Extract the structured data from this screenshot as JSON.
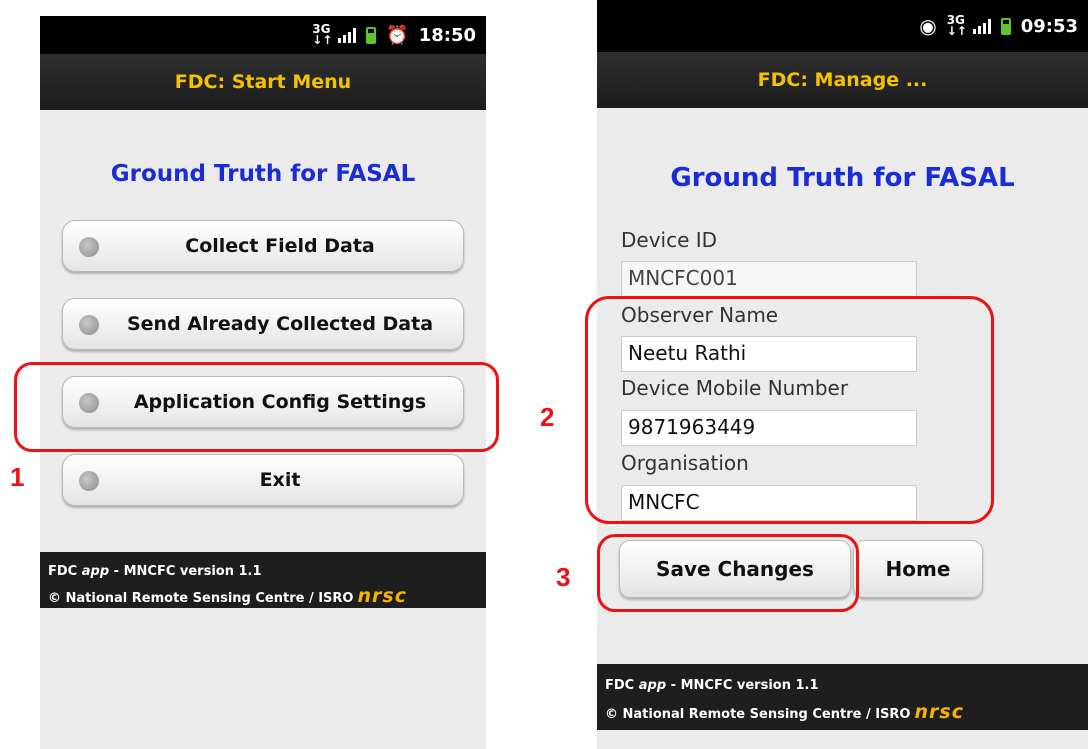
{
  "left_screen": {
    "status": {
      "network": "3G",
      "time": "18:50",
      "icons": [
        "3g-icon",
        "signal-icon",
        "battery-icon",
        "alarm-icon"
      ]
    },
    "title": "FDC: Start Menu",
    "heading": "Ground Truth for FASAL",
    "menu": [
      {
        "label": "Collect Field Data"
      },
      {
        "label": "Send Already Collected Data"
      },
      {
        "label": "Application Config Settings"
      },
      {
        "label": "Exit"
      }
    ],
    "footer": {
      "line1_prefix": "FDC ",
      "line1_app": "app",
      "line1_suffix": " - MNCFC version 1.1",
      "line2": "© National Remote Sensing Centre / ISRO",
      "logo": "nrsc"
    }
  },
  "right_screen": {
    "status": {
      "network": "3G",
      "time": "09:53",
      "icons": [
        "gps-icon",
        "3g-icon",
        "signal-icon",
        "battery-icon"
      ]
    },
    "title": "FDC: Manage ...",
    "heading": "Ground Truth for FASAL",
    "fields": [
      {
        "label": "Device ID",
        "value": "MNCFC001",
        "disabled": true
      },
      {
        "label": "Observer Name",
        "value": "Neetu Rathi"
      },
      {
        "label": "Device Mobile Number",
        "value": "9871963449"
      },
      {
        "label": "Organisation",
        "value": "MNCFC"
      }
    ],
    "buttons": {
      "save": "Save Changes",
      "home": "Home"
    },
    "footer": {
      "line1_prefix": "FDC ",
      "line1_app": "app",
      "line1_suffix": " - MNCFC version 1.1",
      "line2": "© National Remote Sensing Centre / ISRO",
      "logo": "nrsc"
    }
  },
  "callouts": [
    "1",
    "2",
    "3"
  ],
  "colors": {
    "accent_title": "#f5c200",
    "heading": "#1b2bd6",
    "callout": "#ee1111",
    "logo": "#f6b400"
  }
}
